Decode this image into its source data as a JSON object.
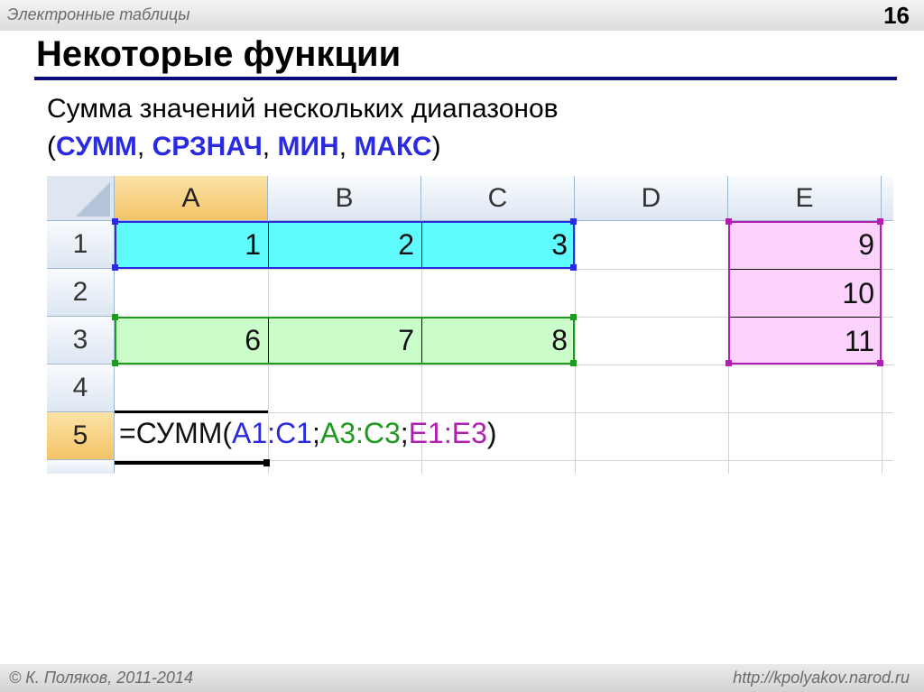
{
  "header": {
    "title": "Электронные таблицы",
    "slide_number": "16"
  },
  "heading": "Некоторые функции",
  "subtitle": {
    "line1": "Сумма значений нескольких диапазонов",
    "open": "(",
    "functions": [
      "СУММ",
      "СРЗНАЧ",
      "МИН",
      "МАКС"
    ],
    "sep": ", ",
    "close": ")"
  },
  "spreadsheet": {
    "columns": [
      "A",
      "B",
      "C",
      "D",
      "E"
    ],
    "rows": [
      "1",
      "2",
      "3",
      "4",
      "5"
    ],
    "active_row": "5",
    "cells": {
      "A1": "1",
      "B1": "2",
      "C1": "3",
      "A3": "6",
      "B3": "7",
      "C3": "8",
      "E1": "9",
      "E2": "10",
      "E3": "11"
    },
    "formula": {
      "prefix": "=СУММ(",
      "range1": "A1:C1",
      "sep1": ";",
      "range2": "A3:C3",
      "sep2": ";",
      "range3": "E1:E3",
      "suffix": ")"
    },
    "range_colors": {
      "range1": "#2a2ae0",
      "range2": "#1e9a1e",
      "range3": "#b020b0"
    }
  },
  "footer": {
    "left": "© К. Поляков, 2011-2014",
    "right": "http://kpolyakov.narod.ru"
  }
}
